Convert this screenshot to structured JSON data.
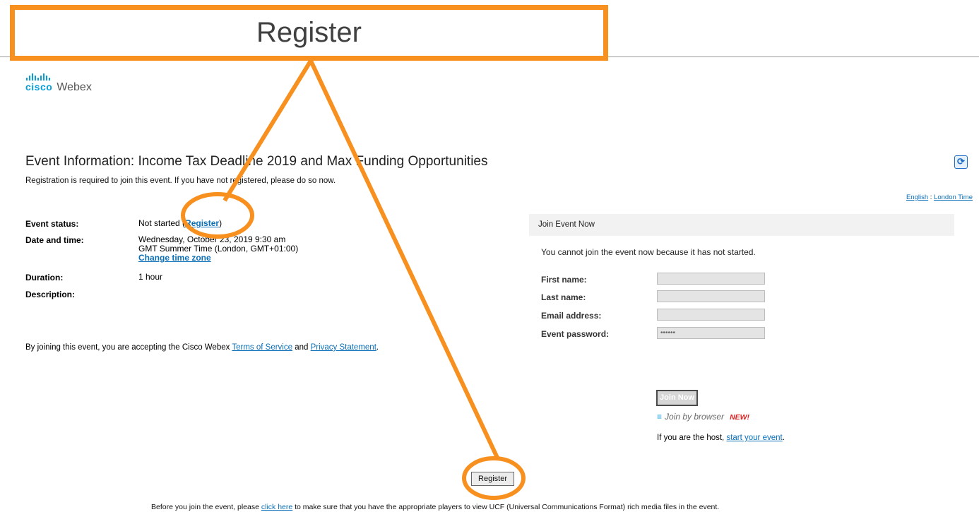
{
  "callout": {
    "label": "Register"
  },
  "brand": {
    "cisco": "cisco",
    "webex": "Webex"
  },
  "page": {
    "title": "Event Information: Income Tax Deadline 2019 and Max Funding Opportunities",
    "subtitle": "Registration is required to join this event. If you have not registered, please do so now.",
    "refresh_icon": "refresh-icon"
  },
  "locale": {
    "language": "English",
    "separator": " : ",
    "timezone": "London Time"
  },
  "event": {
    "status_label": "Event status:",
    "status_prefix": "Not started (",
    "status_link": "Register",
    "status_suffix": ")",
    "date_label": "Date and time:",
    "date_line1": "Wednesday, October 23, 2019 9:30 am",
    "date_line2": "GMT Summer Time (London, GMT+01:00)",
    "change_tz": "Change time zone",
    "duration_label": "Duration:",
    "duration": "1 hour",
    "description_label": "Description:"
  },
  "terms": {
    "prefix": "By joining this event, you are accepting the Cisco Webex ",
    "tos": "Terms of Service",
    "and": " and ",
    "privacy": "Privacy Statement",
    "suffix": "."
  },
  "join": {
    "header": "Join Event Now",
    "message": "You cannot join the event now because it has not started.",
    "first_name_label": "First name:",
    "last_name_label": "Last name:",
    "email_label": "Email address:",
    "password_label": "Event password:",
    "first_name_value": "",
    "last_name_value": "",
    "email_value": "",
    "password_value": "••••••",
    "join_button": "Join Now",
    "browser_label": "Join by browser",
    "browser_badge": "NEW!",
    "host_prefix": "If you are the host, ",
    "host_link": "start your event",
    "host_suffix": "."
  },
  "register_button": "Register",
  "footer": {
    "prefix": "Before you join the event, please ",
    "link": "click here",
    "suffix": " to make sure that you have the appropriate players to view UCF (Universal Communications Format) rich media files in the event."
  },
  "colors": {
    "callout": "#f7901e",
    "link": "#0a6fb8",
    "cisco_blue": "#049fd9",
    "new_badge": "#e02020"
  }
}
